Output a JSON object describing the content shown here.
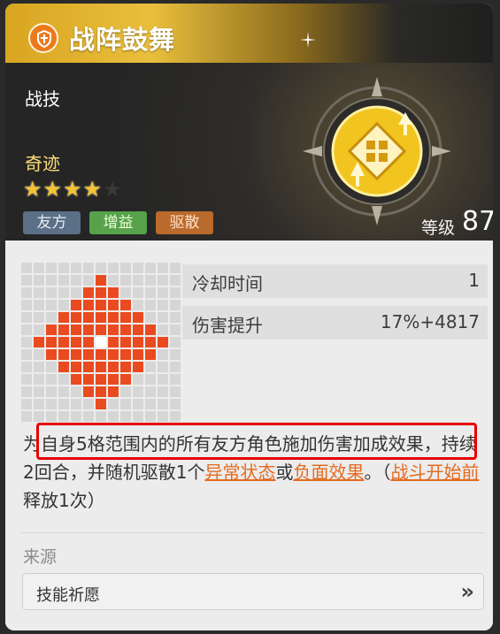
{
  "skill": {
    "name": "战阵鼓舞",
    "category": "战技",
    "rarity": "奇迹",
    "stars_filled": 4,
    "stars_total": 5,
    "tags": [
      "友方",
      "增益",
      "驱散"
    ],
    "level_label": "等级",
    "level_value": "87"
  },
  "stats": [
    {
      "label": "冷却时间",
      "value": "1"
    },
    {
      "label": "伤害提升",
      "value": "17%+4817"
    }
  ],
  "description": {
    "p1": "为自身5格范围内的所有友方角色施加伤害加成效果，持续2回合，并随机驱散1个",
    "link1": "异常状态",
    "p2": "或",
    "link2": "负面效果",
    "p3": "。（",
    "link3": "战斗开始前",
    "p4": "释放1次）"
  },
  "source": {
    "label": "来源",
    "value": "技能祈愿"
  },
  "range_grid": {
    "size": 13,
    "center": [
      6,
      6
    ],
    "radius": 5,
    "colors": {
      "area": "#ea4a1f",
      "empty": "#d6d6d6",
      "center": "#ffffff"
    }
  },
  "icons": [
    "skill-class-icon",
    "star-icon",
    "skill-emblem-icon",
    "chevron-right-icon"
  ]
}
